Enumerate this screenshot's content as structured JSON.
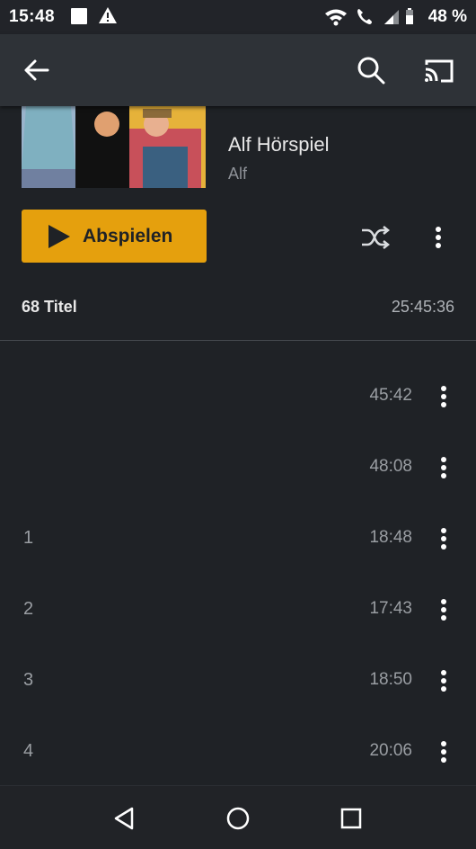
{
  "status": {
    "time": "15:48",
    "battery": "48 %"
  },
  "icons": {
    "back": "arrow-left-icon",
    "search": "search-icon",
    "cast": "cast-icon",
    "play": "play-icon",
    "shuffle": "shuffle-icon",
    "more": "more-vert-icon"
  },
  "album": {
    "title": "Alf Hörspiel",
    "artist": "Alf"
  },
  "actions": {
    "play_label": "Abspielen"
  },
  "summary": {
    "count": "68 Titel",
    "total_duration": "25:45:36"
  },
  "tracks": [
    {
      "number": "",
      "duration": "45:42"
    },
    {
      "number": "",
      "duration": "48:08"
    },
    {
      "number": "1",
      "duration": "18:48"
    },
    {
      "number": "2",
      "duration": "17:43"
    },
    {
      "number": "3",
      "duration": "18:50"
    },
    {
      "number": "4",
      "duration": "20:06"
    }
  ],
  "colors": {
    "accent": "#e5a00d",
    "background": "#1f2226",
    "appbar": "#2e3237"
  }
}
